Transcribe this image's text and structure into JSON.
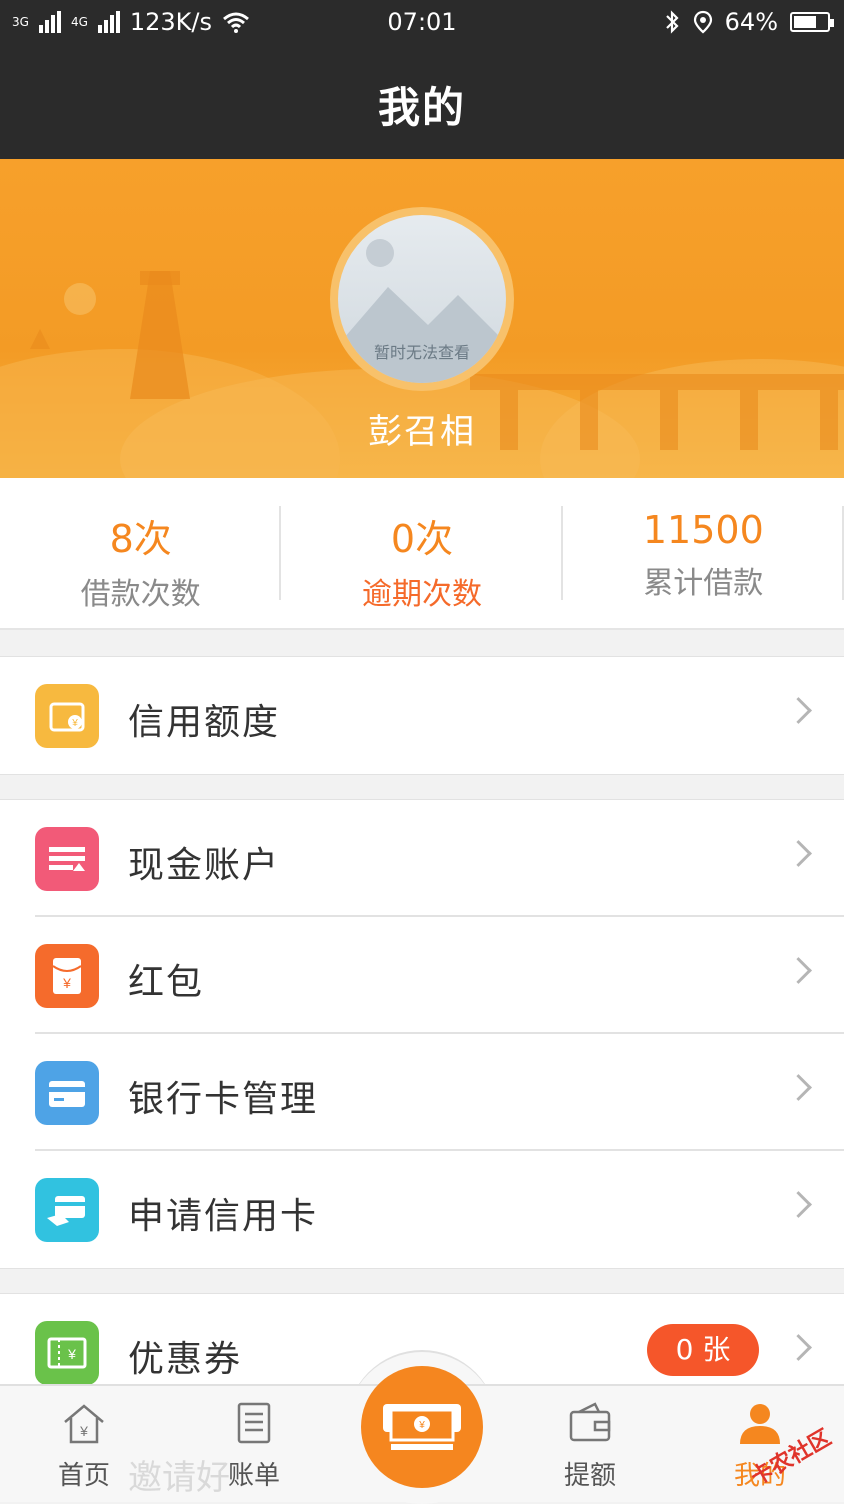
{
  "status_bar": {
    "network": "123K/s",
    "time": "07:01",
    "battery": "64%",
    "sig1": "3G",
    "sig2": "4G"
  },
  "nav": {
    "title": "我的"
  },
  "profile": {
    "avatar_caption": "暂时无法查看",
    "name": "彭召相"
  },
  "stats": [
    {
      "value": "8次",
      "label": "借款次数"
    },
    {
      "value": "0次",
      "label": "逾期次数"
    },
    {
      "value": "11500",
      "label": "累计借款"
    }
  ],
  "menu": {
    "credit": {
      "label": "信用额度",
      "icon": "wallet-icon",
      "color": "#f7b93f"
    },
    "cash": {
      "label": "现金账户",
      "icon": "cash-icon",
      "color": "#f25a78"
    },
    "redpacket": {
      "label": "红包",
      "icon": "red-packet-icon",
      "color": "#f56b2c"
    },
    "bankcard": {
      "label": "银行卡管理",
      "icon": "bank-card-icon",
      "color": "#4ea3e6"
    },
    "creditcard": {
      "label": "申请信用卡",
      "icon": "credit-card-icon",
      "color": "#31c2e0"
    },
    "coupon": {
      "label": "优惠券",
      "icon": "coupon-icon",
      "color": "#6ac24a",
      "badge": "0 张"
    },
    "invite_partial": "邀请好"
  },
  "tabs": {
    "home": "首页",
    "bill": "账单",
    "raise": "提额",
    "mine": "我的"
  },
  "watermark": "卡农社区",
  "colors": {
    "accent": "#f5871f",
    "dark": "#2b2b2b"
  }
}
